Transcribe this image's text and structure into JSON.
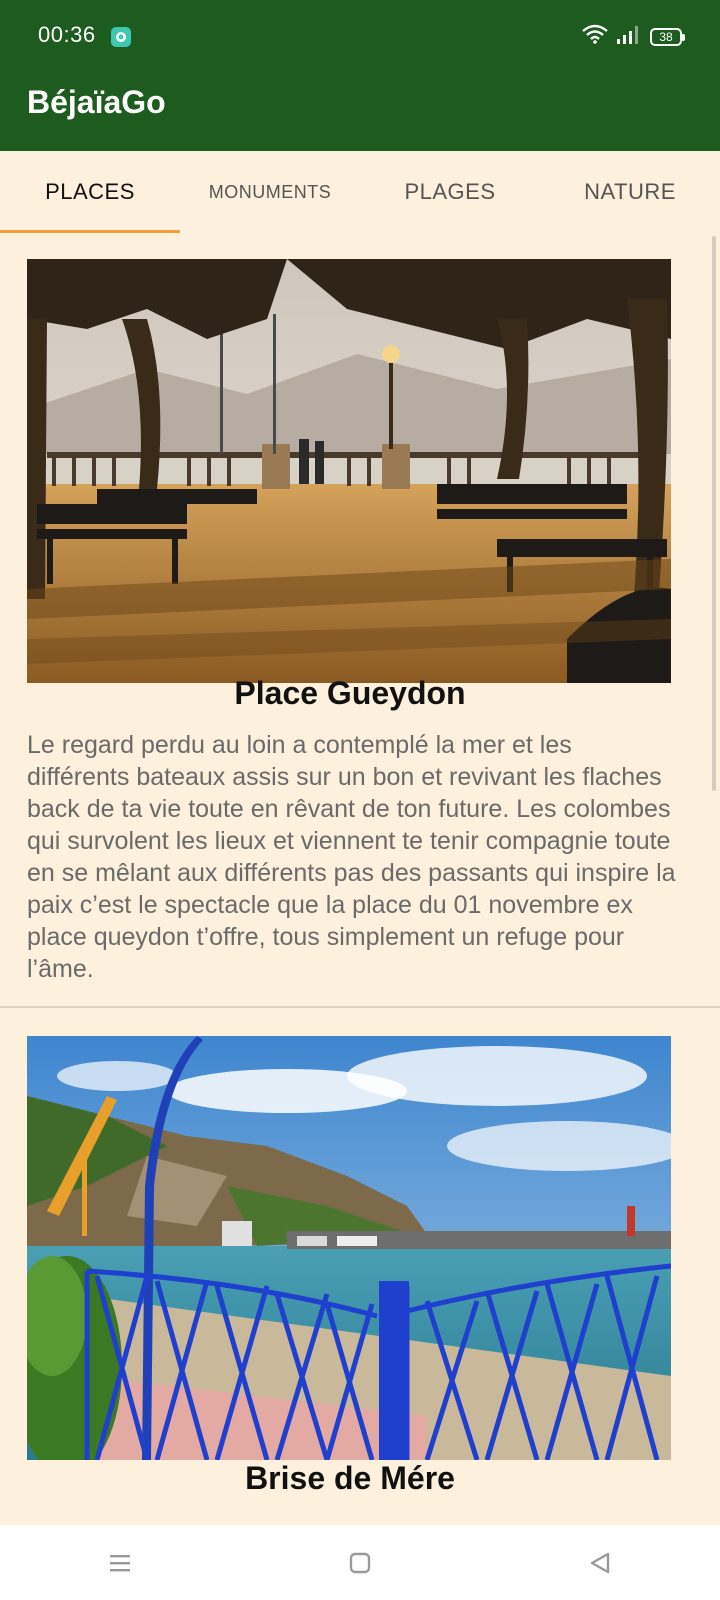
{
  "status_bar": {
    "time": "00:36",
    "battery": "38",
    "icons": [
      "chat-bubble-icon",
      "wifi-icon",
      "signal-icon",
      "battery-icon"
    ]
  },
  "app": {
    "title": "BéjaïaGo",
    "primary_color": "#1e5b1f",
    "accent_color": "#f3a03a",
    "background_color": "#fdf0dc"
  },
  "tabs": [
    {
      "label": "PLACES",
      "active": true
    },
    {
      "label": "MONUMENTS",
      "active": false
    },
    {
      "label": "PLAGES",
      "active": false
    },
    {
      "label": "NATURE",
      "active": false
    }
  ],
  "places": [
    {
      "title": "Place Gueydon",
      "image": "seafront-promenade-trees-benches",
      "description": "Le regard perdu au loin a contemplé la mer et les différents bateaux assis sur un bon et revivant les flaches back de ta vie toute en rêvant de ton future. Les colombes qui survolent les lieux et viennent te tenir compagnie toute en se mêlant aux différents pas des passants qui inspire la paix c’est le spectacle que la place du 01 novembre ex place queydon t’offre, tous simplement un refuge pour l’âme."
    },
    {
      "title": "Brise de Mére",
      "image": "harbour-blue-railing-mountain",
      "description": ""
    }
  ],
  "nav_bar": {
    "icons": [
      "menu-icon",
      "home-square-icon",
      "back-triangle-icon"
    ]
  }
}
